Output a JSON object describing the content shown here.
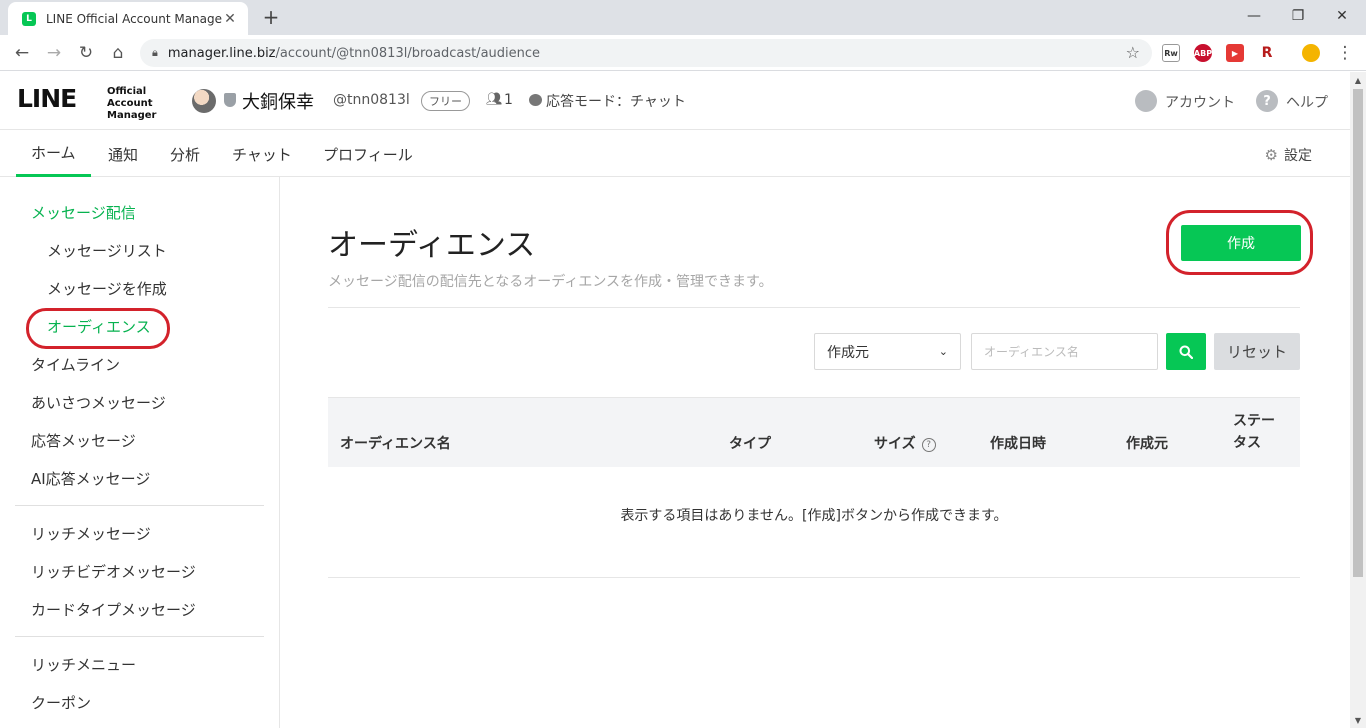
{
  "browser": {
    "tab_title": "LINE Official Account Manager",
    "favicon_letter": "L",
    "url_host": "manager.line.biz",
    "url_path": "/account/@tnn0813l/broadcast/audience",
    "extensions": [
      {
        "label": "Rw",
        "color": "#ffffff"
      },
      {
        "label": "ABP",
        "color": "#c8102e"
      },
      {
        "label": "▶",
        "color": "#e53935"
      },
      {
        "label": "R",
        "color": "#b71c1c"
      },
      {
        "label": "",
        "color": "#f4b400"
      }
    ]
  },
  "header": {
    "logo_main": "LINE",
    "logo_sub": "Official Account Manager",
    "account_name": "大銅保幸",
    "account_id": "@tnn0813l",
    "plan": "フリー",
    "friends_count": "1",
    "mode": "応答モード：チャット",
    "account_label": "アカウント",
    "help_label": "ヘルプ",
    "help_glyph": "?"
  },
  "mainnav": {
    "items": [
      "ホーム",
      "通知",
      "分析",
      "チャット",
      "プロフィール"
    ],
    "settings_label": "設定"
  },
  "sidebar": {
    "items": [
      {
        "label": "メッセージ配信"
      },
      {
        "label": "メッセージリスト"
      },
      {
        "label": "メッセージを作成"
      },
      {
        "label": "オーディエンス"
      },
      {
        "label": "タイムライン"
      },
      {
        "label": "あいさつメッセージ"
      },
      {
        "label": "応答メッセージ"
      },
      {
        "label": "AI応答メッセージ"
      },
      {
        "label": "リッチメッセージ"
      },
      {
        "label": "リッチビデオメッセージ"
      },
      {
        "label": "カードタイプメッセージ"
      },
      {
        "label": "リッチメニュー"
      },
      {
        "label": "クーポン"
      }
    ]
  },
  "main": {
    "title": "オーディエンス",
    "description": "メッセージ配信の配信先となるオーディエンスを作成・管理できます。",
    "create_label": "作成",
    "filter_value": "作成元",
    "search_placeholder": "オーディエンス名",
    "reset_label": "リセット",
    "columns": [
      "オーディエンス名",
      "タイプ",
      "サイズ",
      "作成日時",
      "作成元",
      "ステー\nタス"
    ],
    "empty_message": "表示する項目はありません。[作成]ボタンから作成できます。"
  },
  "colors": {
    "brand_green": "#06c755",
    "annotation_red": "#d3222b"
  }
}
